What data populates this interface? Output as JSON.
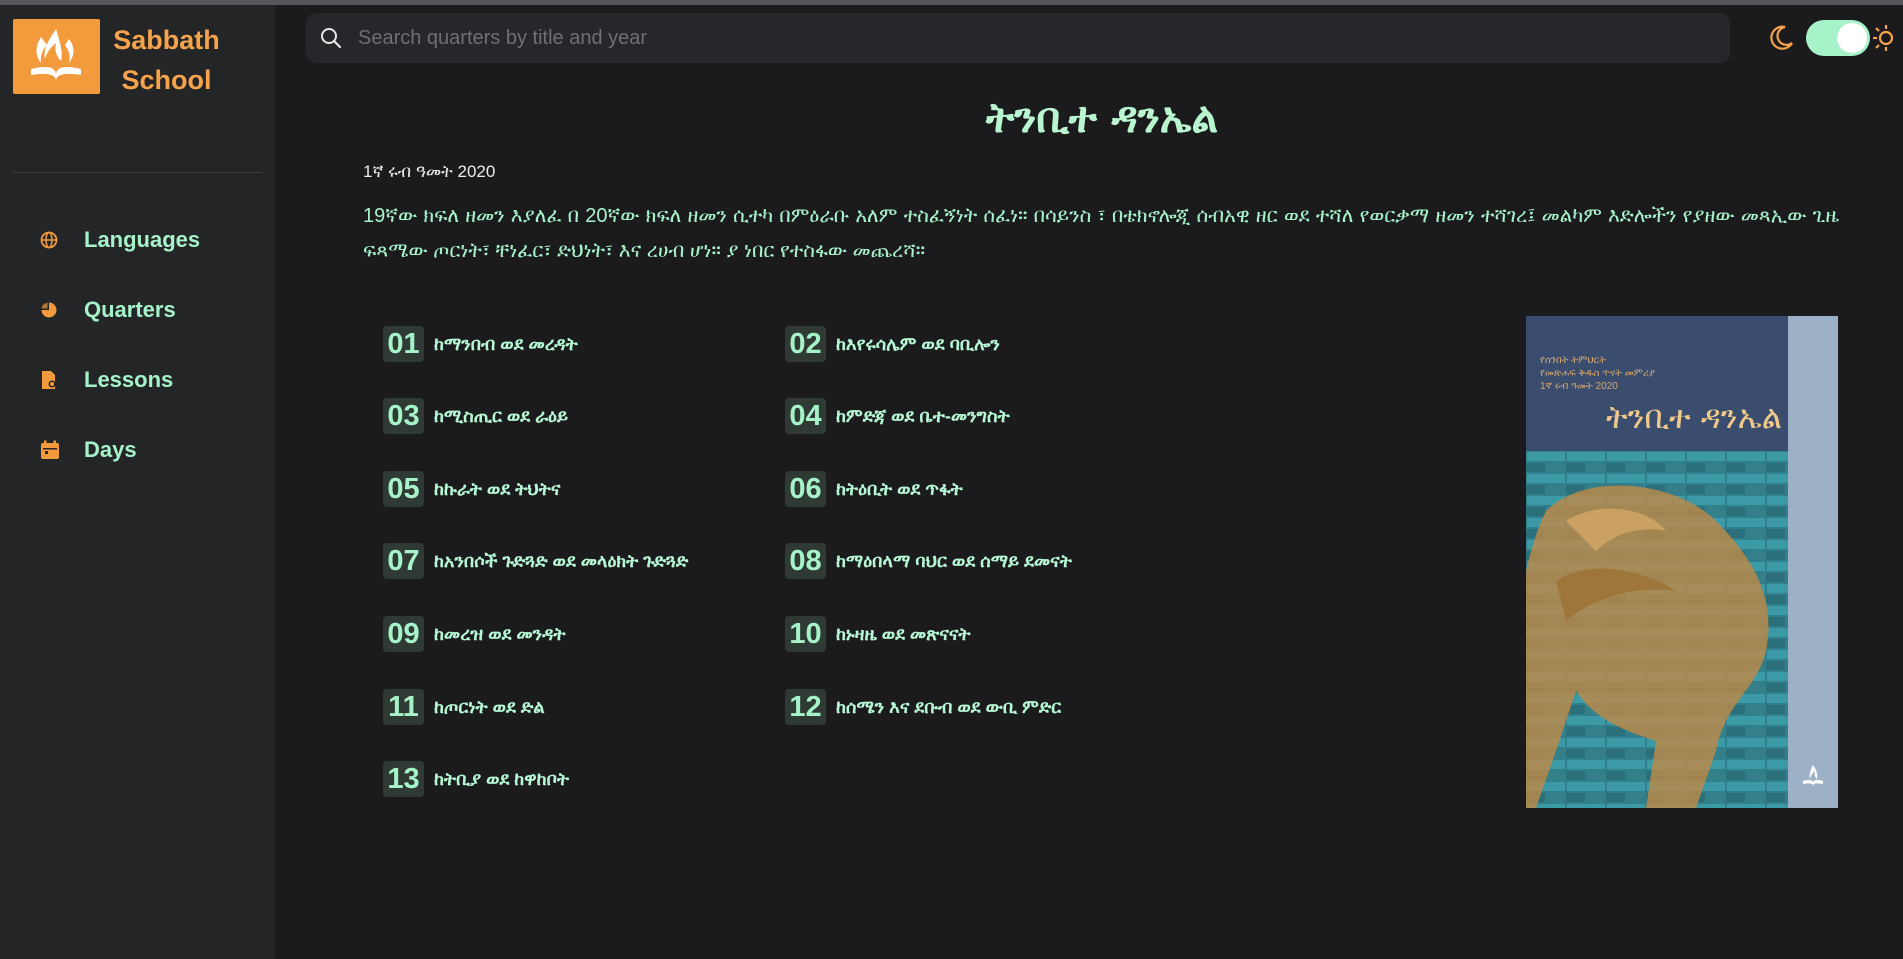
{
  "app": {
    "name": "Sabbath School"
  },
  "sidebar": {
    "items": [
      {
        "label": "Languages",
        "icon": "globe-icon"
      },
      {
        "label": "Quarters",
        "icon": "pie-chart-icon"
      },
      {
        "label": "Lessons",
        "icon": "document-icon"
      },
      {
        "label": "Days",
        "icon": "calendar-icon"
      }
    ]
  },
  "search": {
    "placeholder": "Search quarters by title and year"
  },
  "theme": {
    "mode": "dark",
    "icons": [
      "moon-icon",
      "sun-icon"
    ]
  },
  "quarter": {
    "title": "ትንቢተ ዳንኤል",
    "date": "1ኛ ሩብ ዓመት 2020",
    "description": "19ኛው ክፍለ ዘመን እያለፈ በ 20ኛው ክፍለ ዘመን ሲተካ በምዕራቡ አለም ተስፈኝነት ሰፈነ። በሳይንስ ፣ በቴክኖሎጂ ሰብአዊ ዘር ወደ ተሻለ የወርቃማ ዘመን ተሻገረ፤ መልካም እድሎችን የያዘው መጻኢው ጊዜ ፍጻሜው ጦርነት፣ ቸነፈር፣ ድህነት፣ እና ረሀብ ሆነ። ያ ነበር የተስፋው መጨረሻ።",
    "cover": {
      "small_lines": [
        "የሰንበት ትምህርት",
        "የመጽሐፍ ቅዱስ ጥናት መምሪያ",
        "1ኛ ሩብ ዓመት 2020"
      ],
      "title": "ትንቢተ ዳንኤል"
    }
  },
  "lessons": [
    {
      "num": "01",
      "title": "ከማንበብ ወደ መረዳት"
    },
    {
      "num": "02",
      "title": "ከእየሩሳሌም ወደ ባቢሎን"
    },
    {
      "num": "03",
      "title": "ከሚስጢር ወደ ራዕይ"
    },
    {
      "num": "04",
      "title": "ከምድጃ ወደ ቤተ-መንግስት"
    },
    {
      "num": "05",
      "title": "ከኩራት ወደ ትህትና"
    },
    {
      "num": "06",
      "title": "ከትዕቢት ወደ ጥፋት"
    },
    {
      "num": "07",
      "title": "ከአንበሶች ጉድጓድ ወደ መላዕክት ጉድጓድ"
    },
    {
      "num": "08",
      "title": "ከማዕበላማ ባህር ወደ ሰማይ ደመናት"
    },
    {
      "num": "09",
      "title": "ከመረዝ ወደ መንዳት"
    },
    {
      "num": "10",
      "title": "ከኑዛዜ ወደ መጽናናት"
    },
    {
      "num": "11",
      "title": "ከጦርነት ወደ ድል"
    },
    {
      "num": "12",
      "title": "ከሰሜን እና ደቡብ ወደ ውቢ ምድር"
    },
    {
      "num": "13",
      "title": "ከትቢያ ወደ ከዋከቦት"
    }
  ],
  "colors": {
    "accent": "#a7f3c9",
    "brand": "#f39a3c",
    "background": "#1b1b1d",
    "sidebar": "#242526"
  }
}
